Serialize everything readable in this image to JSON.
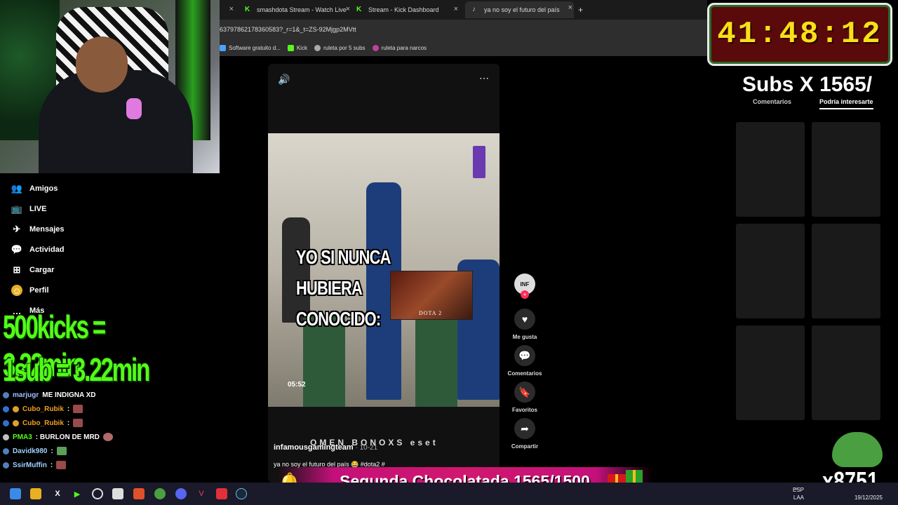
{
  "browser": {
    "tabs": [
      {
        "label": "",
        "close": "×"
      },
      {
        "label": "smashdota Stream - Watch Live",
        "close": "×"
      },
      {
        "label": "Stream - Kick Dashboard",
        "close": "×"
      },
      {
        "label": "ya no soy el futuro del país",
        "close": "×"
      }
    ],
    "new_tab": "+",
    "address": "6379786217836058​3?_r=1&_t=ZS-92Mjgp2MVtt",
    "bookmarks": [
      {
        "label": "Software gratuito d...",
        "color": "#4aa3ff"
      },
      {
        "label": "Kick",
        "color": "#53fc18"
      },
      {
        "label": "ruleta por 5 subs",
        "color": "#aaaaaa"
      },
      {
        "label": "ruleta para narcos",
        "color": "#c040a0"
      }
    ]
  },
  "sidebar": {
    "items": [
      {
        "label": "Amigos",
        "icon": "friends-icon",
        "glyph": "👥"
      },
      {
        "label": "LIVE",
        "icon": "live-icon",
        "glyph": "📺"
      },
      {
        "label": "Mensajes",
        "icon": "messages-icon",
        "glyph": "✈"
      },
      {
        "label": "Actividad",
        "icon": "activity-icon",
        "glyph": "💬"
      },
      {
        "label": "Cargar",
        "icon": "upload-icon",
        "glyph": "⊞"
      },
      {
        "label": "Perfil",
        "icon": "profile-icon",
        "glyph": "☺"
      },
      {
        "label": "Más",
        "icon": "more-icon",
        "glyph": "…"
      }
    ]
  },
  "overlay": {
    "line1": "500kicks = 3.22min",
    "line2": "1sub = 3.22min"
  },
  "chat": [
    {
      "user": "marjugr",
      "msg": "ME INDIGNA XD",
      "color": "#a0c0ff"
    },
    {
      "user": "Cubo_Rubik",
      "msg": ":",
      "color": "#f0a020"
    },
    {
      "user": "Cubo_Rubik",
      "msg": ":",
      "color": "#f0a020"
    },
    {
      "user": "PMA3",
      "msg": ": BURLON DE MRD",
      "color": "#53fc18"
    },
    {
      "user": "Davidk980",
      "msg": ":",
      "color": "#a0d0ff"
    },
    {
      "user": "SsirMuffin",
      "msg": ":",
      "color": "#a0d0ff"
    }
  ],
  "video": {
    "meme_line1": "YO SI NUNCA HUBIERA",
    "meme_line2": "CONOCIDO:",
    "dota_label": "DOTA 2",
    "timestamp": "05:52",
    "author": "infamousgamingteam",
    "date": " · 10-21",
    "caption": "ya no soy el futuro del país 😂 #dota2 #",
    "sponsors": "OMEN  BONOXS  eset"
  },
  "rail": {
    "avatar": "INF",
    "like": "Me gusta",
    "comments": "Comentarios",
    "favorites": "Favoritos",
    "share": "Compartir"
  },
  "timer": "41:48:12",
  "right": {
    "subs_title": "Subs X 1565/",
    "tab_comments": "Comentarios",
    "tab_interesting": "Podría interesarte"
  },
  "banner": "Segunda Chocolatada 1565/1500",
  "kick_count": "x8751",
  "tray": {
    "lang": "ESP",
    "layout": "LAA",
    "date": "19/12/2025"
  }
}
